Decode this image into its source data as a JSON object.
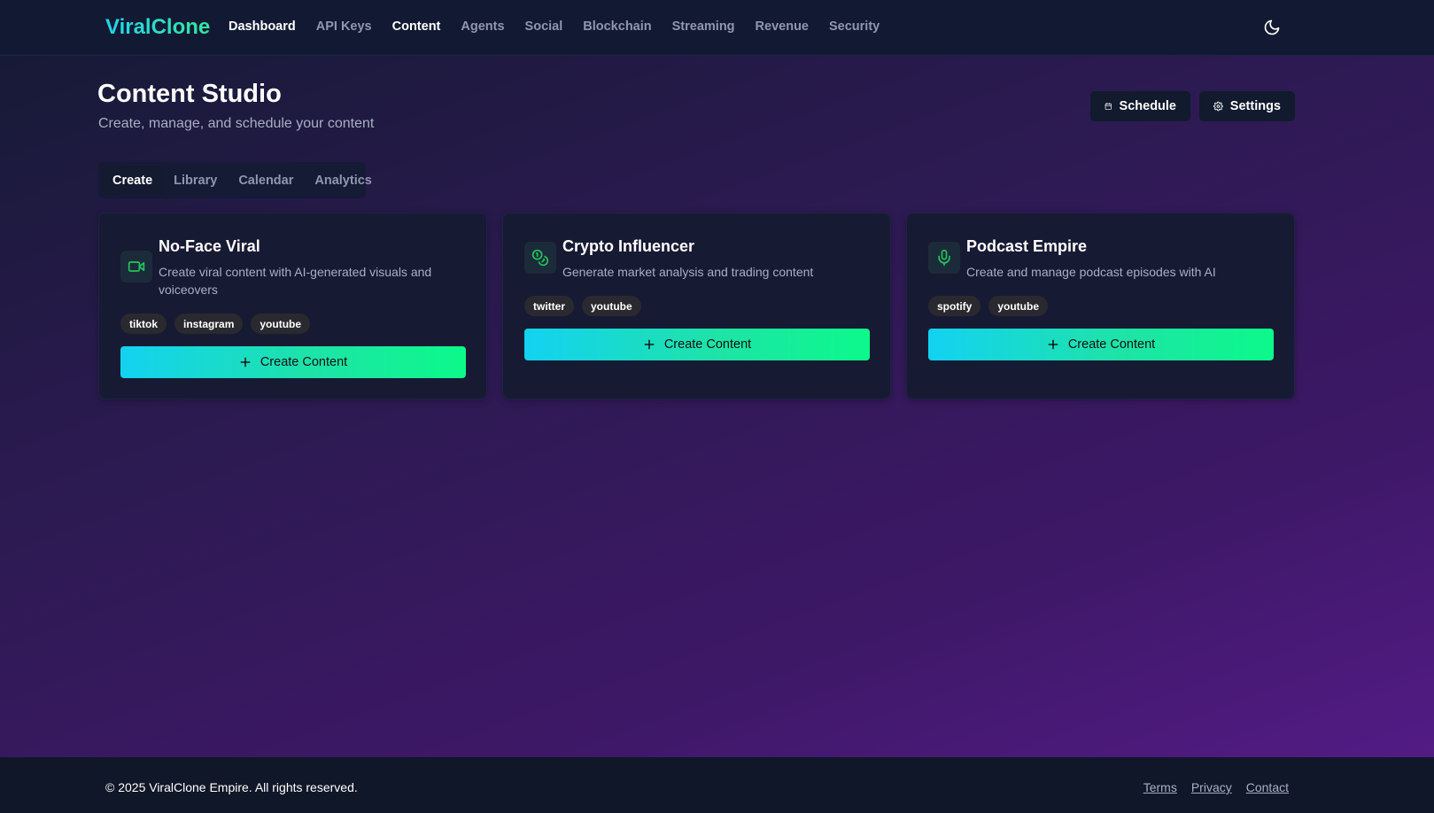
{
  "nav": {
    "brand": "ViralClone",
    "links": [
      "Dashboard",
      "API Keys",
      "Content",
      "Agents",
      "Social",
      "Blockchain",
      "Streaming",
      "Revenue",
      "Security"
    ],
    "active": "Content",
    "theme_icon": "moon-icon"
  },
  "header": {
    "title": "Content Studio",
    "subtitle": "Create, manage, and schedule your content",
    "schedule_label": "Schedule",
    "settings_label": "Settings"
  },
  "tabs": [
    "Create",
    "Library",
    "Calendar",
    "Analytics"
  ],
  "active_tab": "Create",
  "cards": [
    {
      "title": "No-Face Viral",
      "description": "Create viral content with AI-generated visuals and voiceovers",
      "icon": "video-icon",
      "tags": [
        "tiktok",
        "instagram",
        "youtube"
      ],
      "button": "Create Content"
    },
    {
      "title": "Crypto Influencer",
      "description": "Generate market analysis and trading content",
      "icon": "coins-icon",
      "tags": [
        "twitter",
        "youtube"
      ],
      "button": "Create Content"
    },
    {
      "title": "Podcast Empire",
      "description": "Create and manage podcast episodes with AI",
      "icon": "microphone-icon",
      "tags": [
        "spotify",
        "youtube"
      ],
      "button": "Create Content"
    }
  ],
  "footer": {
    "copyright": "© 2025 ViralClone Empire. All rights reserved.",
    "links": [
      "Terms",
      "Privacy",
      "Contact"
    ]
  },
  "colors": {
    "accent_start": "#13d2f2",
    "accent_end": "#0cf98a",
    "icon_green": "#22c55e"
  }
}
